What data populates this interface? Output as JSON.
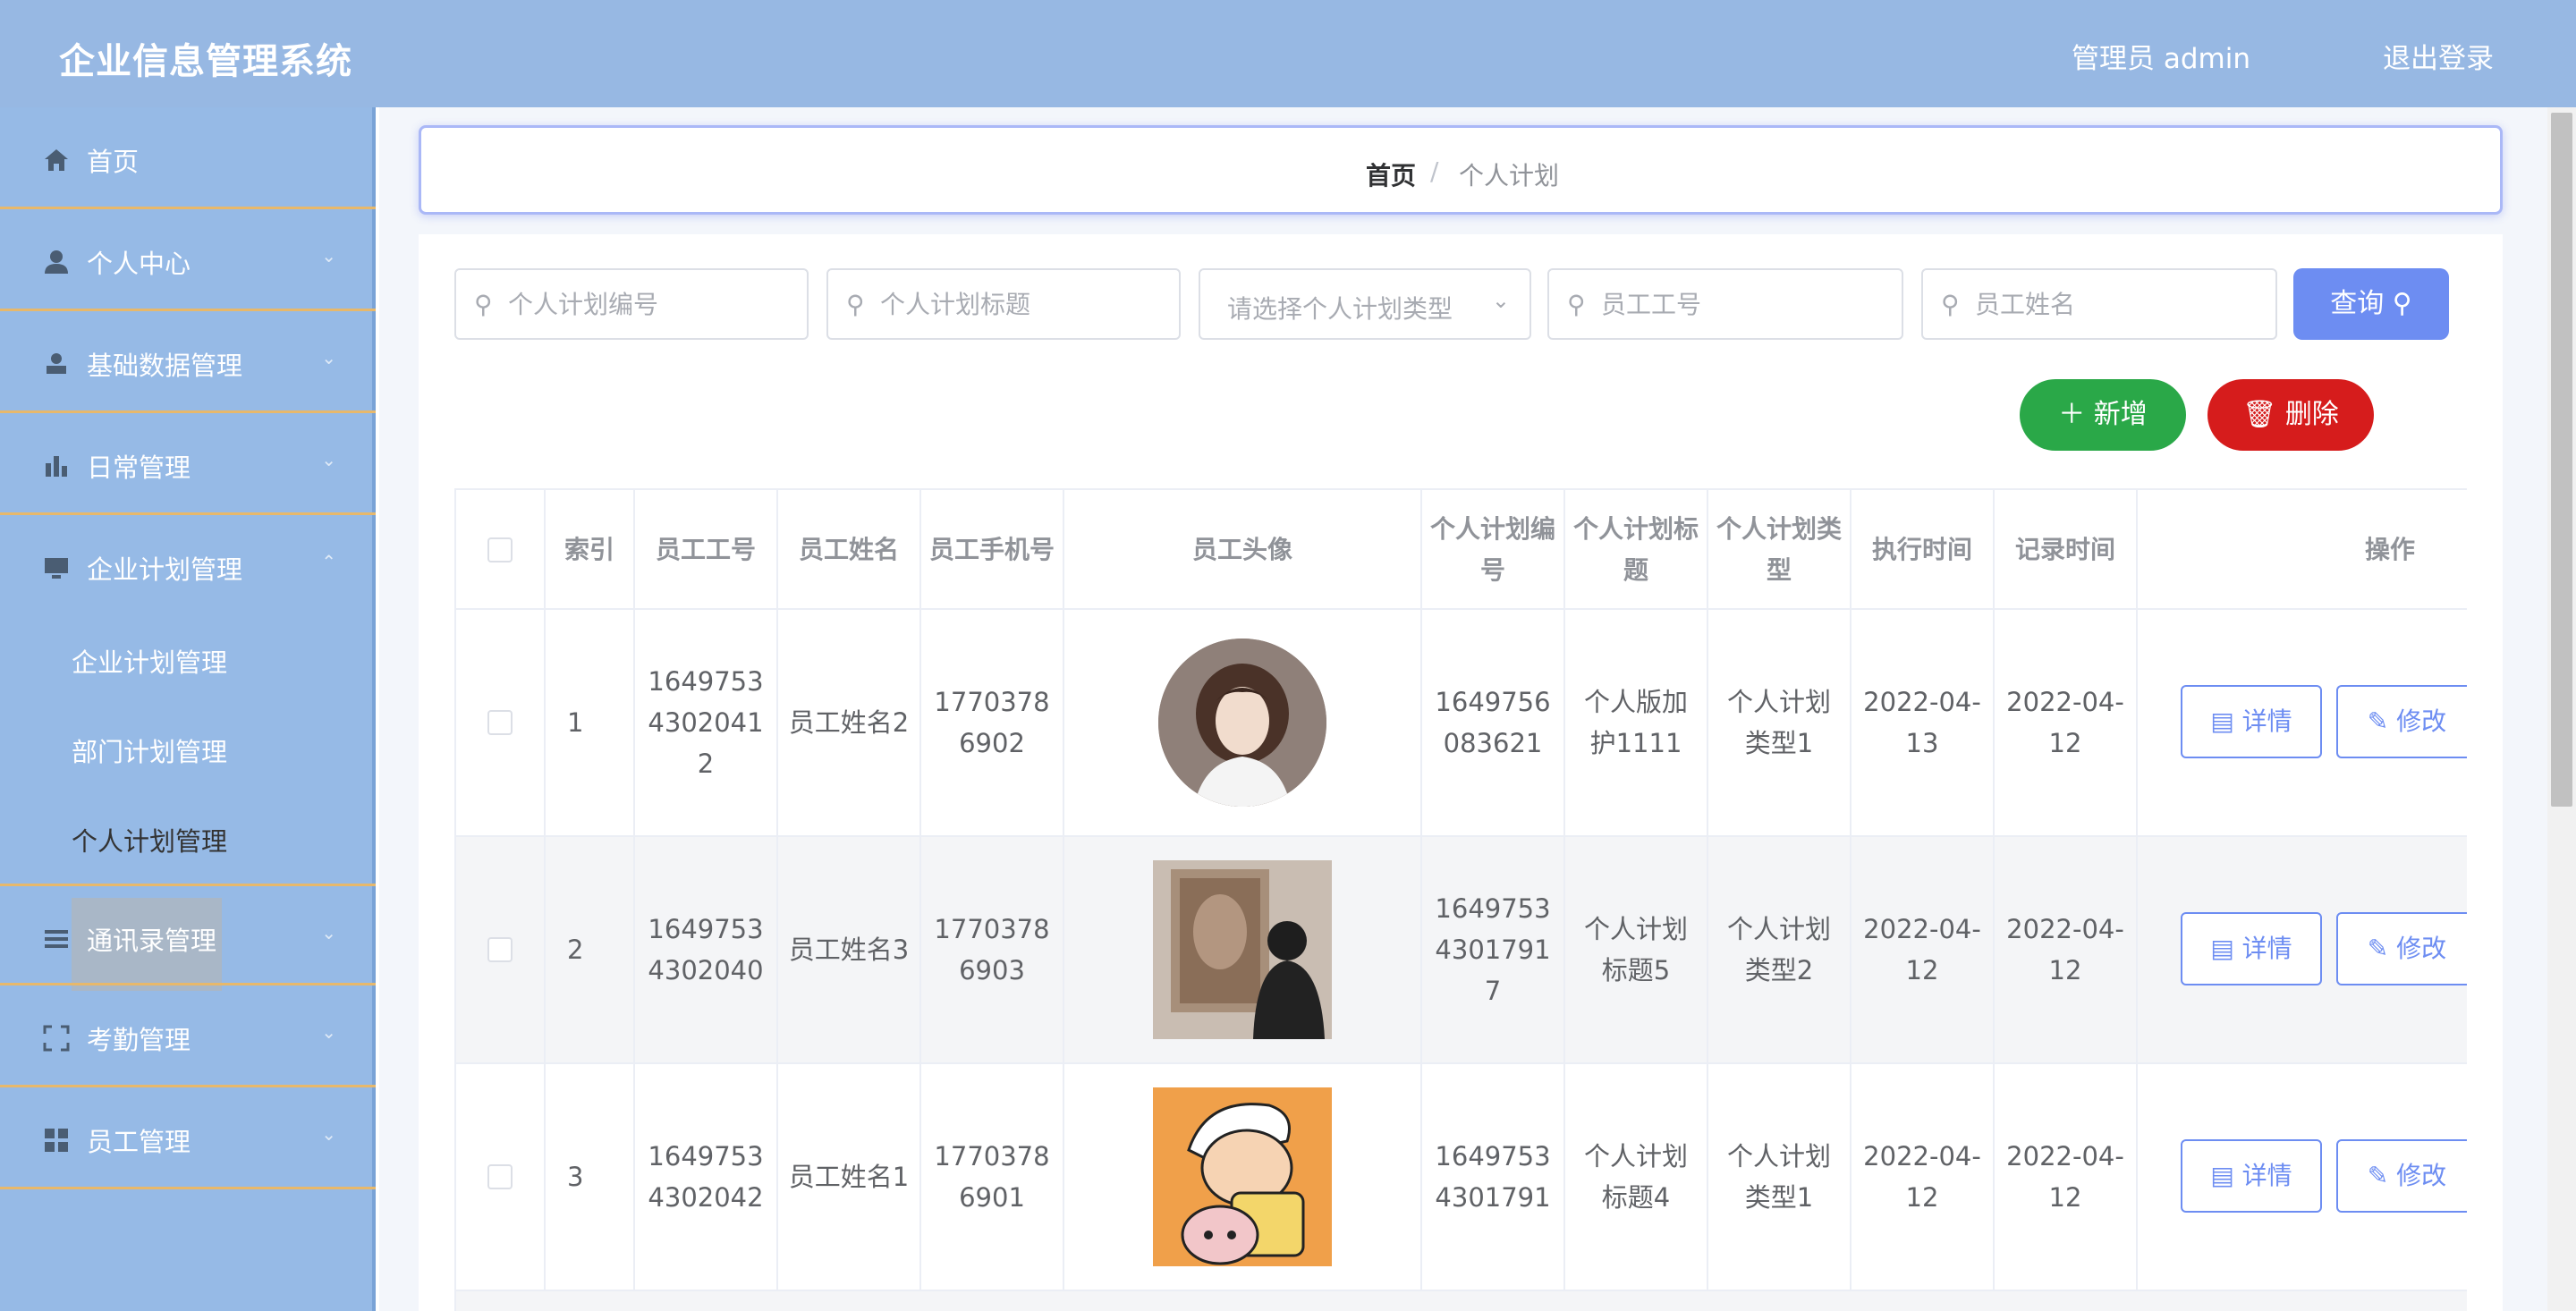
{
  "header": {
    "title": "企业信息管理系统",
    "user": "管理员 admin",
    "logout": "退出登录"
  },
  "sidebar": {
    "items": [
      {
        "label": "首页",
        "icon": "home-icon"
      },
      {
        "label": "个人中心",
        "icon": "user-icon"
      },
      {
        "label": "基础数据管理",
        "icon": "user-icon"
      },
      {
        "label": "日常管理",
        "icon": "bar-chart-icon"
      },
      {
        "label": "企业计划管理",
        "icon": "monitor-icon"
      },
      {
        "label": "通讯录管理",
        "icon": "list-icon"
      },
      {
        "label": "考勤管理",
        "icon": "fullscreen-icon"
      },
      {
        "label": "员工管理",
        "icon": "grid-icon"
      }
    ],
    "submenu": [
      "企业计划管理",
      "部门计划管理",
      "个人计划管理"
    ]
  },
  "breadcrumb": {
    "home": "首页",
    "separator": "/",
    "current": "个人计划"
  },
  "search": {
    "plan_no": "个人计划编号",
    "plan_title": "个人计划标题",
    "plan_type": "请选择个人计划类型",
    "emp_no": "员工工号",
    "emp_name": "员工姓名",
    "query": "查询"
  },
  "actions": {
    "add": "新增",
    "delete": "删除"
  },
  "table": {
    "headers": [
      "索引",
      "员工工号",
      "员工姓名",
      "员工手机号",
      "员工头像",
      "个人计划编号",
      "个人计划标题",
      "个人计划类型",
      "执行时间",
      "记录时间",
      "操作"
    ],
    "rows": [
      {
        "index": "1",
        "emp_no": "16497534302041 2",
        "emp_name": "员工姓名2",
        "phone": "17703786902",
        "plan_no": "1649756083621",
        "title": "个人版加护1111",
        "type": "个人计划类型1",
        "exec": "2022-04-13",
        "record": "2022-04-12"
      },
      {
        "index": "2",
        "emp_no": "16497534302040",
        "emp_name": "员工姓名3",
        "phone": "17703786903",
        "plan_no": "16497534301791 7",
        "title": "个人计划标题5",
        "type": "个人计划类型2",
        "exec": "2022-04-12",
        "record": "2022-04-12"
      },
      {
        "index": "3",
        "emp_no": "16497534302042",
        "emp_name": "员工姓名1",
        "phone": "17703786901",
        "plan_no": "16497534301791",
        "title": "个人计划标题4",
        "type": "个人计划类型1",
        "exec": "2022-04-12",
        "record": "2022-04-12"
      }
    ],
    "detail": "详情",
    "edit": "修改"
  }
}
